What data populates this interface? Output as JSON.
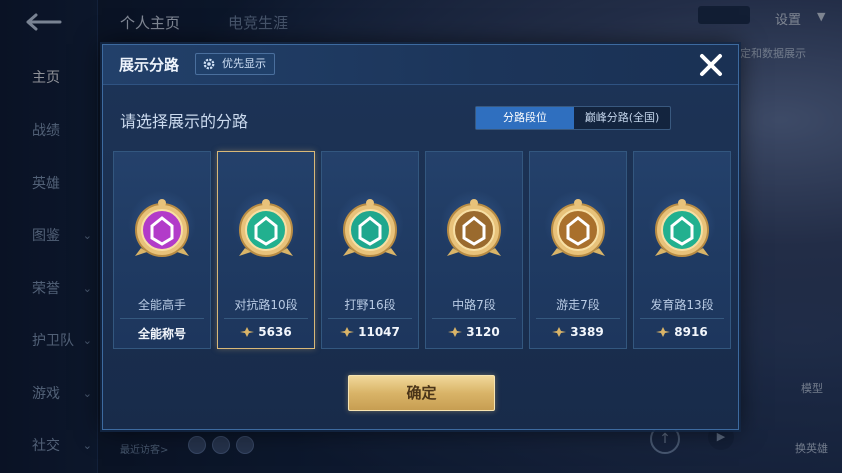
{
  "background": {
    "nav_items": [
      {
        "label": "主页",
        "active": true
      },
      {
        "label": "战绩"
      },
      {
        "label": "英雄"
      },
      {
        "label": "图鉴",
        "arrow": true
      },
      {
        "label": "荣誉",
        "arrow": true
      },
      {
        "label": "护卫队",
        "arrow": true
      },
      {
        "label": "游戏",
        "arrow": true
      },
      {
        "label": "社交",
        "arrow": true
      }
    ],
    "tabs": [
      {
        "label": "个人主页",
        "active": true
      },
      {
        "label": "电竞生涯"
      }
    ],
    "settings_label": "设置",
    "side_text": "定和数据展示",
    "model_label": "模型",
    "hero_label": "换英雄",
    "visitors_label": "最近访客>"
  },
  "modal": {
    "title": "展示分路",
    "priority_button": "优先显示",
    "subtitle": "请选择展示的分路",
    "toggle": {
      "active_label": "分路段位",
      "other_label": "巅峰分路(全国)"
    },
    "cards": [
      {
        "name": "全能高手",
        "value": "全能称号",
        "selected": false,
        "badge_color": "#b23bc9",
        "has_value_icon": false
      },
      {
        "name": "对抗路10段",
        "value": "5636",
        "selected": true,
        "badge_color": "#22b08f",
        "has_value_icon": true
      },
      {
        "name": "打野16段",
        "value": "11047",
        "selected": false,
        "badge_color": "#1fa78e",
        "has_value_icon": true
      },
      {
        "name": "中路7段",
        "value": "3120",
        "selected": false,
        "badge_color": "#9a6a2e",
        "has_value_icon": true
      },
      {
        "name": "游走7段",
        "value": "3389",
        "selected": false,
        "badge_color": "#a9702c",
        "has_value_icon": true
      },
      {
        "name": "发育路13段",
        "value": "8916",
        "selected": false,
        "badge_color": "#22b08f",
        "has_value_icon": true
      }
    ],
    "confirm_label": "确定"
  },
  "colors": {
    "accent_blue": "#2f6fbf",
    "gold": "#d9b468",
    "selected_border": "#d8b878"
  }
}
